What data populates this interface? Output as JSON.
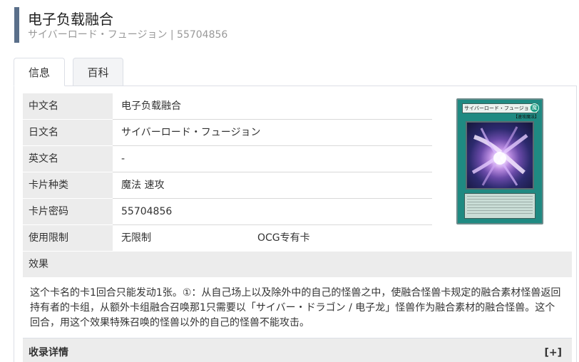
{
  "header": {
    "title": "电子负载融合",
    "subtitle": "サイバーロード・フュージョン | 55704856"
  },
  "tabs": [
    {
      "label": "信息",
      "active": true
    },
    {
      "label": "百科",
      "active": false
    }
  ],
  "info": {
    "rows": [
      {
        "label": "中文名",
        "value": "电子负载融合"
      },
      {
        "label": "日文名",
        "value": "サイバーロード・フュージョン"
      },
      {
        "label": "英文名",
        "value": "-"
      },
      {
        "label": "卡片种类",
        "value": "魔法 速攻"
      },
      {
        "label": "卡片密码",
        "value": "55704856"
      },
      {
        "label": "使用限制",
        "value": "无限制",
        "extra": "OCG专有卡"
      }
    ]
  },
  "effect": {
    "header": "效果",
    "text": "这个卡名的卡1回合只能发动1张。①：从自己场上以及除外中的自己的怪兽之中，使融合怪兽卡规定的融合素材怪兽返回持有者的卡组，从额外卡组融合召唤那1只需要以「サイバー・ドラゴン / 电子龙」怪兽作为融合素材的融合怪兽。这个回合，用这个效果特殊召唤的怪兽以外的自己的怪兽不能攻击。"
  },
  "collection": {
    "header": "收录详情",
    "toggle": "[+]"
  },
  "card_image": {
    "name": "サイバーロード・フュージョン",
    "attribute": "魔",
    "type_line": "【速攻魔法】",
    "frame_color": "#1f8a82"
  },
  "colors": {
    "accent_bar": "#5a6f8a",
    "label_bg": "#ececec",
    "border": "#dcdfe6"
  }
}
